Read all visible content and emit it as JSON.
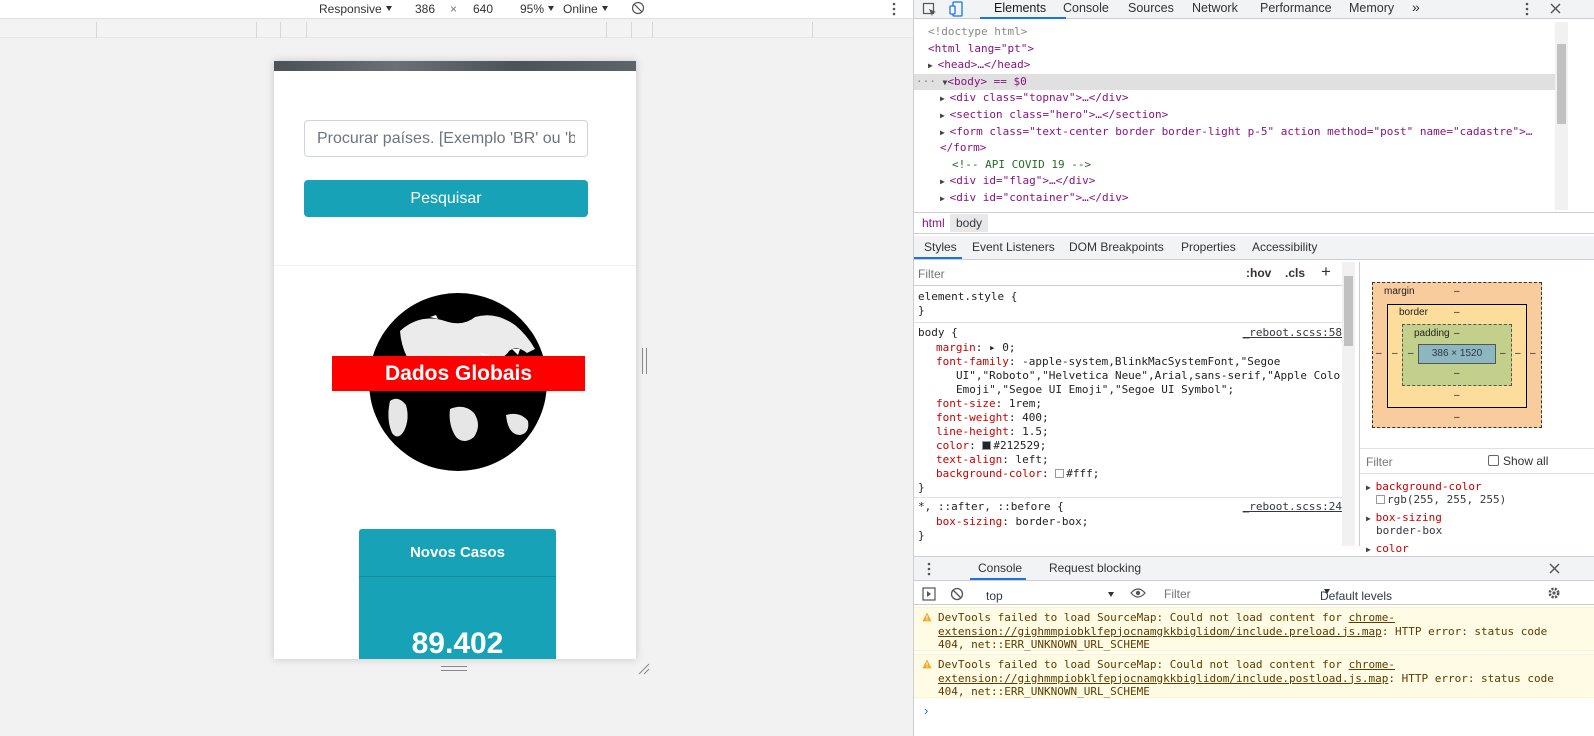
{
  "device_toolbar": {
    "device": "Responsive",
    "width": "386",
    "times": "×",
    "height": "640",
    "zoom": "95%",
    "throttle": "Online"
  },
  "page": {
    "search_placeholder": "Procurar países. [Exemplo 'BR' ou 'brasil']",
    "search_button": "Pesquisar",
    "globe_label": "Dados Globais",
    "cases_title": "Novos Casos",
    "cases_value": "89.402"
  },
  "devtools": {
    "tabs": [
      "Elements",
      "Console",
      "Sources",
      "Network",
      "Performance",
      "Memory"
    ],
    "more": "»",
    "dom": [
      "<!doctype html>",
      "<html lang=\"pt\">",
      "<head>…</head>",
      "<body> == $0",
      "<div class=\"topnav\">…</div>",
      "<section class=\"hero\">…</section>",
      "<form class=\"text-center border border-light p-5\" action method=\"post\" name=\"cadastre\">…",
      "</form>",
      "<!-- API COVID 19 -->",
      "<div id=\"flag\">…</div>",
      "<div id=\"container\">…</div>"
    ],
    "breadcrumb": [
      "html",
      "body"
    ],
    "sub_tabs": [
      "Styles",
      "Event Listeners",
      "DOM Breakpoints",
      "Properties",
      "Accessibility"
    ],
    "styles_filter_placeholder": "Filter",
    "hov": ":hov",
    "cls": ".cls",
    "plus": "+",
    "styles": {
      "element_style": "element.style {",
      "close": "}",
      "body_selector": "body {",
      "body_source": "_reboot.scss:58",
      "props": [
        {
          "name": "margin",
          "value": "▸ 0;"
        },
        {
          "name": "font-family",
          "value": "-apple-system,BlinkMacSystemFont,\"Segoe"
        },
        {
          "name": "",
          "value": "UI\",\"Roboto\",\"Helvetica Neue\",Arial,sans-serif,\"Apple Color"
        },
        {
          "name": "",
          "value": "Emoji\",\"Segoe UI Emoji\",\"Segoe UI Symbol\";"
        },
        {
          "name": "font-size",
          "value": "1rem;"
        },
        {
          "name": "font-weight",
          "value": "400;"
        },
        {
          "name": "line-height",
          "value": "1.5;"
        },
        {
          "name": "color",
          "value": "#212529;"
        },
        {
          "name": "text-align",
          "value": "left;"
        },
        {
          "name": "background-color",
          "value": "#fff;"
        }
      ],
      "universal_selector": "*, ::after, ::before {",
      "universal_source": "_reboot.scss:24",
      "universal_prop": "box-sizing",
      "universal_value": "border-box;"
    },
    "box_model": {
      "margin": "margin",
      "border": "border",
      "padding": "padding",
      "dash": "–",
      "content": "386 × 1520"
    },
    "computed": {
      "filter_placeholder": "Filter",
      "show_all": "Show all",
      "items": [
        {
          "name": "background-color",
          "value": "rgb(255, 255, 255)"
        },
        {
          "name": "box-sizing",
          "value": "border-box"
        },
        {
          "name": "color",
          "value": ""
        }
      ]
    },
    "drawer_tabs": [
      "Console",
      "Request blocking"
    ],
    "console_context": "top",
    "console_filter_placeholder": "Filter",
    "default_levels": "Default levels",
    "messages": [
      {
        "prefix": "DevTools failed to load SourceMap: Could not load content for ",
        "link": "chrome-extension://gighmmpiobklfepjocnamgkkbiglidom/include.preload.js.map",
        "suffix": ": HTTP error: status code 404, net::ERR_UNKNOWN_URL_SCHEME"
      },
      {
        "prefix": "DevTools failed to load SourceMap: Could not load content for ",
        "link": "chrome-extension://gighmmpiobklfepjocnamgkkbiglidom/include.postload.js.map",
        "suffix": ": HTTP error: status code 404, net::ERR_UNKNOWN_URL_SCHEME"
      }
    ],
    "prompt": "›"
  },
  "colors": {
    "accent": "#17a2b8",
    "globe_banner": "#ff0000",
    "devtools_tab_underline": "#1a73e8"
  },
  "icons": [
    "rotate-icon",
    "kebab-menu-icon",
    "inspect-icon",
    "device-toggle-icon",
    "close-icon",
    "sidebar-toggle-icon",
    "clear-console-icon",
    "eye-icon",
    "gear-icon",
    "warning-icon",
    "resize-handle-icon"
  ]
}
